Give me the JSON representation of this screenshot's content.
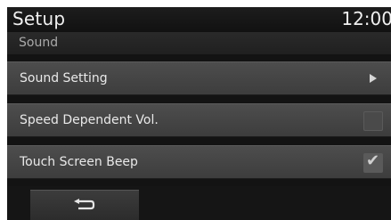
{
  "header": {
    "title": "Setup",
    "clock": "12:00"
  },
  "section": {
    "label": "Sound"
  },
  "items": [
    {
      "label": "Sound Setting",
      "control": "arrow-right-icon"
    },
    {
      "label": "Speed Dependent Vol.",
      "control": "checkbox",
      "checked": false
    },
    {
      "label": "Touch Screen Beep",
      "control": "checkbox",
      "checked": true
    }
  ],
  "footer": {
    "back_icon": "back-arrow-icon"
  },
  "colors": {
    "background": "#131313",
    "row": "#454545",
    "text": "#e9e9e9",
    "subtext": "#a9a9a9"
  }
}
